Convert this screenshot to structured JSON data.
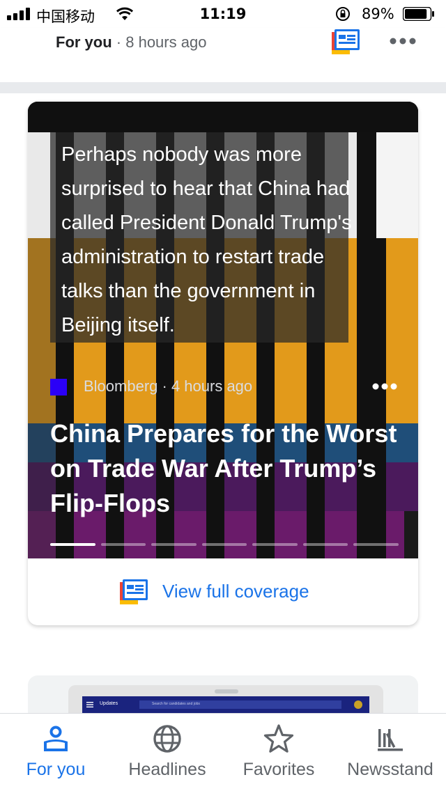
{
  "status_bar": {
    "carrier": "中国移动",
    "time": "11:19",
    "battery_percent": "89%",
    "battery_level": 0.89
  },
  "top_story": {
    "source": "For you",
    "separator": " · ",
    "time_ago": "8 hours ago"
  },
  "main_card": {
    "quote": "Perhaps nobody was more surprised to hear that China had called President Donald Trump's administration to restart trade talks than the government in Beijing itself.",
    "publisher": "Bloomberg",
    "separator": " · ",
    "time_ago": "4 hours ago",
    "headline": "China Prepares for the Worst on Trade War After Trump’s Flip-Flops",
    "pager_total": 7,
    "pager_active_index": 0,
    "coverage_label": "View full coverage"
  },
  "next_card": {
    "app_title": "Updates",
    "search_placeholder": "Search for candidates and jobs"
  },
  "bottom_nav": {
    "for_you": "For you",
    "headlines": "Headlines",
    "favorites": "Favorites",
    "newsstand": "Newsstand"
  },
  "colors": {
    "accent_blue": "#1a73e8",
    "bloomberg_purple": "#2b00f7",
    "chart_orange": "#e29a1b",
    "chart_blue": "#1f4e79",
    "chart_purple": "#4b1a5c",
    "chart_magenta": "#6a1b6a"
  },
  "icons": {
    "signal": "signal-icon",
    "wifi": "wifi-icon",
    "lock": "orientation-lock-icon",
    "battery": "battery-icon",
    "google_news": "google-news-icon",
    "more": "more-horizontal-icon",
    "for_you": "person-icon",
    "headlines": "globe-icon",
    "favorites": "star-icon",
    "newsstand": "newsstand-icon"
  }
}
